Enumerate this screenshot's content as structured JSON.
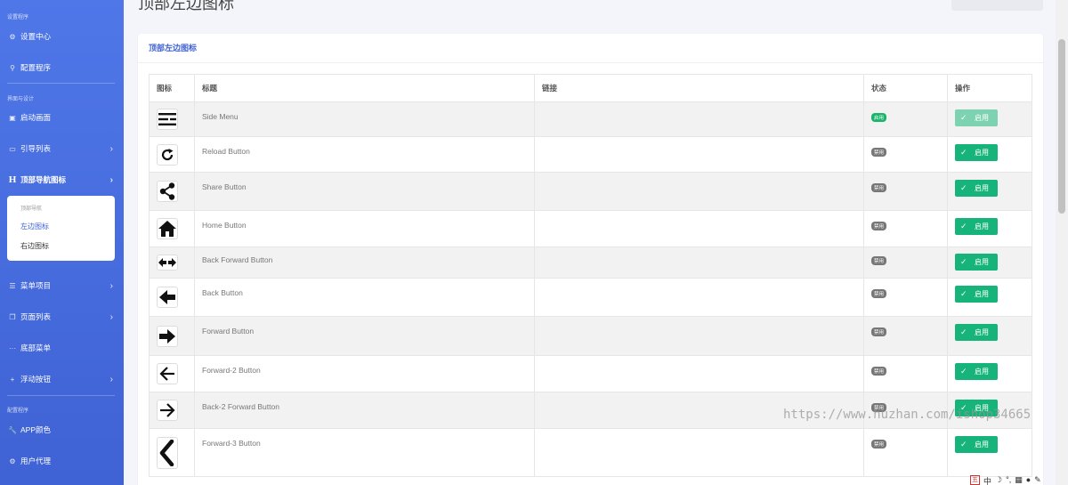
{
  "page": {
    "title": "顶部左边图标"
  },
  "sidebar": {
    "section_settings": "设置程序",
    "settings_center": "设置中心",
    "config_program": "配置程序",
    "section_ui": "界面与设计",
    "splash": "启动画面",
    "guide_list": "引导列表",
    "top_nav": "顶部导航图标",
    "sub_head": "顶部导航",
    "left_icons": "左边图标",
    "right_icons": "右边图标",
    "menu_items": "菜单项目",
    "page_list": "页面列表",
    "bottom_menu": "底部菜单",
    "float_button": "浮动按钮",
    "section_config": "配置程序",
    "app_color": "APP颜色",
    "user_agent": "用户代理"
  },
  "card": {
    "title": "顶部左边图标"
  },
  "table": {
    "headers": {
      "icon": "图标",
      "title": "标题",
      "link": "链接",
      "status": "状态",
      "action": "操作"
    },
    "rows": [
      {
        "icon": "menu-lines-icon",
        "title": "Side Menu",
        "link": "",
        "status": "启用",
        "action": "启用",
        "enabled": true
      },
      {
        "icon": "reload-icon",
        "title": "Reload Button",
        "link": "",
        "status": "禁用",
        "action": "启用",
        "enabled": false
      },
      {
        "icon": "share-icon",
        "title": "Share Button",
        "link": "",
        "status": "禁用",
        "action": "启用",
        "enabled": false
      },
      {
        "icon": "home-icon",
        "title": "Home Button",
        "link": "",
        "status": "禁用",
        "action": "启用",
        "enabled": false
      },
      {
        "icon": "back-forward-icon",
        "title": "Back Forward Button",
        "link": "",
        "status": "禁用",
        "action": "启用",
        "enabled": false
      },
      {
        "icon": "arrow-left-bold-icon",
        "title": "Back Button",
        "link": "",
        "status": "禁用",
        "action": "启用",
        "enabled": false
      },
      {
        "icon": "arrow-right-bold-icon",
        "title": "Forward Button",
        "link": "",
        "status": "禁用",
        "action": "启用",
        "enabled": false
      },
      {
        "icon": "arrow-left-thin-icon",
        "title": "Forward-2 Button",
        "link": "",
        "status": "禁用",
        "action": "启用",
        "enabled": false
      },
      {
        "icon": "arrow-right-thin-icon",
        "title": "Back-2 Forward Button",
        "link": "",
        "status": "禁用",
        "action": "启用",
        "enabled": false
      },
      {
        "icon": "chevron-left-icon",
        "title": "Forward-3 Button",
        "link": "",
        "status": "禁用",
        "action": "启用",
        "enabled": false
      }
    ]
  },
  "watermark": "https://www.huzhan.com/ishop34665",
  "tray": {
    "lang": "中"
  },
  "colors": {
    "sidebar": "#4f77e8",
    "accent": "#3f62d4",
    "success": "#16b47a",
    "badge_off": "#777777"
  }
}
